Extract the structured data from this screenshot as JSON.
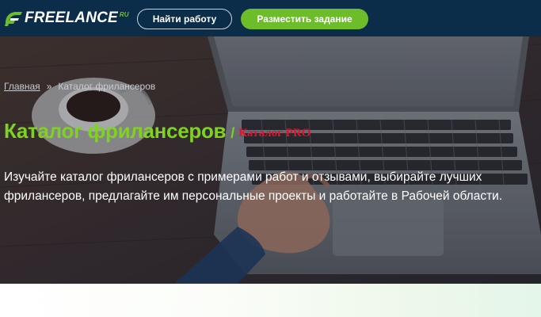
{
  "header": {
    "logo_text": "FREELANCE",
    "logo_sup": "RU",
    "find_work_label": "Найти работу",
    "post_task_label": "Разместить задание"
  },
  "breadcrumb": {
    "home": "Главная",
    "separator": "»",
    "current": "Каталог фрилансеров"
  },
  "page": {
    "title": "Каталог фрилансеров",
    "title_slash": "/",
    "pro_link": "Каталог PRO",
    "description": "Изучайте каталог фрилансеров с примерами работ и отзывами, выбирайте лучших фрилансеров, предлагайте им персональные проекты и работайте в Рабочей области."
  },
  "colors": {
    "header_bg": "#0b2d4a",
    "accent_green": "#6dbd2b",
    "title_green": "#7ed321",
    "pro_red": "#e8102a"
  },
  "icons": {
    "logo": "freelance-logo-icon"
  }
}
